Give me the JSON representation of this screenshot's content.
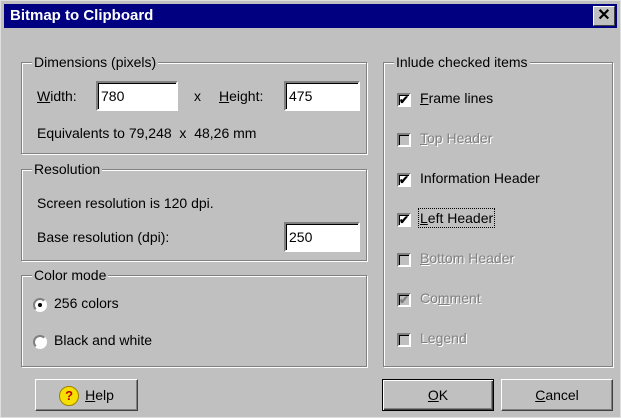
{
  "window": {
    "title": "Bitmap to Clipboard",
    "close_glyph": "✕"
  },
  "dimensions": {
    "legend": "Dimensions (pixels)",
    "width_label_u": "W",
    "width_label_rest": "idth:",
    "width_value": "780",
    "x_sep": "x",
    "height_label_u": "H",
    "height_label_rest": "eight:",
    "height_value": "475",
    "equivalents": "Equivalents to 79,248  x  48,26 mm"
  },
  "resolution": {
    "legend": "Resolution",
    "screen_text": "Screen resolution is 120 dpi.",
    "base_label": "Base resolution (dpi):",
    "base_value": "250"
  },
  "color_mode": {
    "legend": "Color mode",
    "option_256": "256 colors",
    "option_bw": "Black and white",
    "selected": "256 colors"
  },
  "include": {
    "legend": "Inlude checked items",
    "items": [
      {
        "u": "F",
        "rest": "rame lines",
        "checked": true,
        "enabled": true
      },
      {
        "u": "T",
        "rest": "op Header",
        "checked": false,
        "enabled": false
      },
      {
        "pre": "Information Header",
        "checked": true,
        "enabled": true
      },
      {
        "u": "L",
        "rest": "eft Header",
        "checked": true,
        "enabled": true
      },
      {
        "u": "B",
        "rest": "ottom Header",
        "checked": false,
        "enabled": false
      },
      {
        "pre": "Co",
        "u": "m",
        "rest": "ment",
        "checked": true,
        "enabled": false
      },
      {
        "pre": "Le",
        "u": "g",
        "rest": "end",
        "checked": false,
        "enabled": false
      }
    ]
  },
  "buttons": {
    "help_u": "H",
    "help_rest": "elp",
    "help_icon": "?",
    "ok_u": "O",
    "ok_rest": "K",
    "cancel_u": "C",
    "cancel_rest": "ancel"
  },
  "icons": {
    "check": "✔",
    "help": "help-icon"
  }
}
